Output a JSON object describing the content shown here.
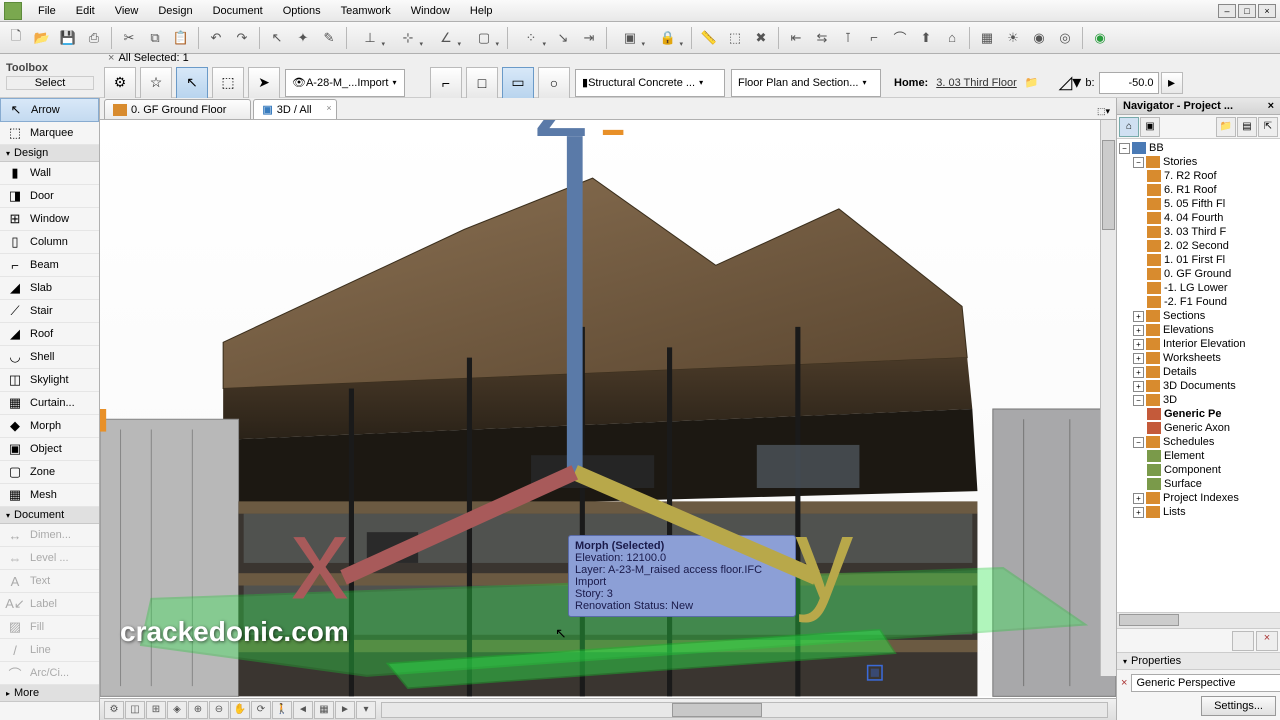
{
  "menu": [
    "File",
    "Edit",
    "View",
    "Design",
    "Document",
    "Options",
    "Teamwork",
    "Window",
    "Help"
  ],
  "toolbox": {
    "title": "Toolbox",
    "select_label": "Select",
    "arrow": "Arrow",
    "marquee": "Marquee",
    "design_section": "Design",
    "document_section": "Document",
    "more_section": "More",
    "design_tools": [
      {
        "icon": "▮",
        "label": "Wall"
      },
      {
        "icon": "◨",
        "label": "Door"
      },
      {
        "icon": "⊞",
        "label": "Window"
      },
      {
        "icon": "▯",
        "label": "Column"
      },
      {
        "icon": "⌐",
        "label": "Beam"
      },
      {
        "icon": "◢",
        "label": "Slab"
      },
      {
        "icon": "⟋",
        "label": "Stair"
      },
      {
        "icon": "◢",
        "label": "Roof"
      },
      {
        "icon": "◡",
        "label": "Shell"
      },
      {
        "icon": "◫",
        "label": "Skylight"
      },
      {
        "icon": "▦",
        "label": "Curtain..."
      },
      {
        "icon": "◆",
        "label": "Morph"
      },
      {
        "icon": "▣",
        "label": "Object"
      },
      {
        "icon": "▢",
        "label": "Zone"
      },
      {
        "icon": "▦",
        "label": "Mesh"
      }
    ],
    "doc_tools": [
      {
        "icon": "↔",
        "label": "Dimen..."
      },
      {
        "icon": "⇔",
        "label": "Level ..."
      },
      {
        "icon": "A",
        "label": "Text"
      },
      {
        "icon": "A↙",
        "label": "Label"
      },
      {
        "icon": "▨",
        "label": "Fill"
      },
      {
        "icon": "/",
        "label": "Line"
      },
      {
        "icon": "⌒",
        "label": "Arc/Ci..."
      }
    ]
  },
  "infobar": {
    "sel_count": "All Selected: 1",
    "layer_combo": "A-28-M_...Import",
    "material_combo": "Structural Concrete ...",
    "plan_combo": "Floor Plan and Section...",
    "home_label": "Home:",
    "story": "3. 03 Third Floor",
    "b_label": "b:",
    "b_value": "-50.0"
  },
  "tabs": {
    "t1": "0. GF Ground Floor",
    "t2": "3D / All"
  },
  "tooltip": {
    "title": "Morph (Selected)",
    "l1": "Elevation: 12100.0",
    "l2": "Layer: A-23-M_raised access floor.IFC Import",
    "l3": "Story: 3",
    "l4": "Renovation Status: New"
  },
  "watermark": "crackedonic.com",
  "navigator": {
    "title": "Navigator - Project ...",
    "root": "BB",
    "stories_label": "Stories",
    "stories": [
      "7. R2 Roof",
      "6. R1 Roof",
      "5. 05 Fifth Fl",
      "4. 04 Fourth",
      "3. 03 Third F",
      "2. 02 Second",
      "1. 01 First Fl",
      "0. GF Ground",
      "-1. LG Lower",
      "-2. F1 Found"
    ],
    "groups": [
      "Sections",
      "Elevations",
      "Interior Elevation",
      "Worksheets",
      "Details",
      "3D Documents"
    ],
    "three_d": "3D",
    "gp": "Generic Pe",
    "ga": "Generic Axon",
    "schedules": "Schedules",
    "sched_items": [
      "Element",
      "Component",
      "Surface"
    ],
    "pi": "Project Indexes",
    "lists": "Lists"
  },
  "properties": {
    "title": "Properties",
    "value": "Generic Perspective",
    "settings": "Settings..."
  }
}
